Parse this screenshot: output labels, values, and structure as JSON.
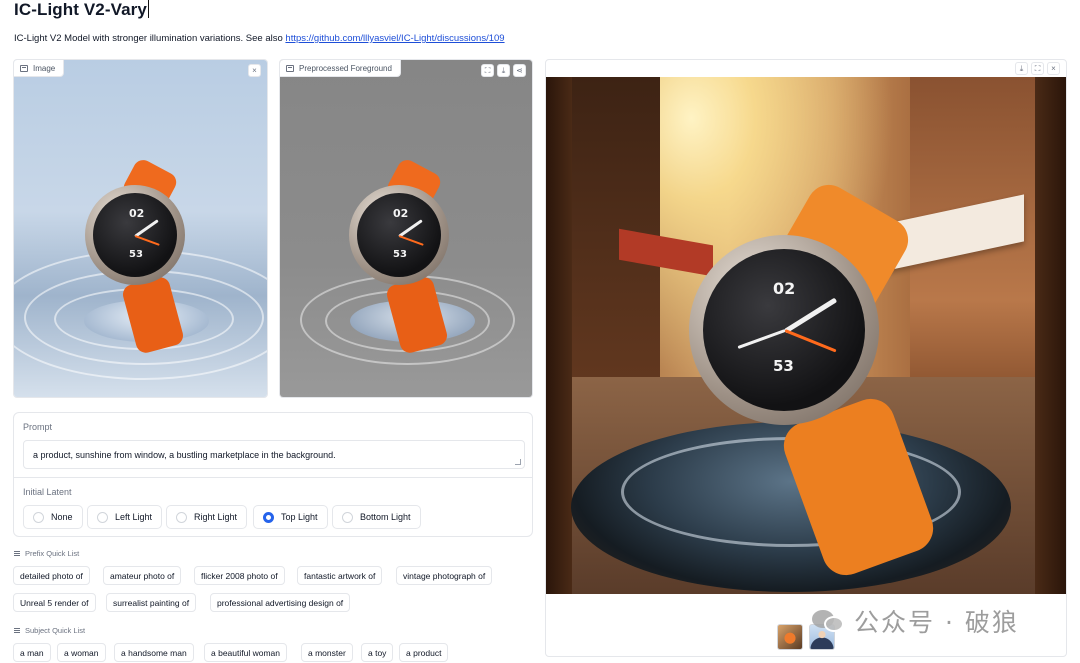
{
  "header": {
    "title": "IC-Light V2-Vary",
    "description": "IC-Light V2 Model with stronger illumination variations. See also ",
    "link_text": "https://github.com/lllyasviel/IC-Light/discussions/109"
  },
  "input_image": {
    "label": "Image",
    "close_symbol": "×"
  },
  "preprocessed": {
    "label": "Preprocessed Foreground",
    "fullscreen_symbol": "⛶",
    "download_symbol": "⤓",
    "share_symbol": "⋖"
  },
  "output": {
    "download_symbol": "⤓",
    "fullscreen_symbol": "⛶",
    "close_symbol": "×"
  },
  "watch_face": {
    "top_digits": "02",
    "bottom_digits": "53"
  },
  "prompt": {
    "label": "Prompt",
    "value": "a product, sunshine from window, a bustling marketplace in the background."
  },
  "initial_latent": {
    "label": "Initial Latent",
    "options": [
      "None",
      "Left Light",
      "Right Light",
      "Top Light",
      "Bottom Light"
    ],
    "selected": "Top Light"
  },
  "prefix_quick_list": {
    "label": "Prefix Quick List",
    "items": [
      "detailed photo of",
      "amateur photo of",
      "flicker 2008 photo of",
      "fantastic artwork of",
      "vintage photograph of",
      "Unreal 5 render of",
      "surrealist painting of",
      "professional advertising design of"
    ]
  },
  "subject_quick_list": {
    "label": "Subject Quick List",
    "items": [
      "a man",
      "a woman",
      "a handsome man",
      "a beautiful woman",
      "a monster",
      "a toy",
      "a product"
    ]
  },
  "gallery_thumbnails": [
    "watch-thumbnail",
    "portrait-thumbnail"
  ],
  "watermark": {
    "text": "公众号 · 破狼"
  },
  "colors": {
    "accent": "#2563eb",
    "link": "#1d4ed8",
    "strap": "#ef6a1e",
    "border": "#e5e7eb"
  }
}
